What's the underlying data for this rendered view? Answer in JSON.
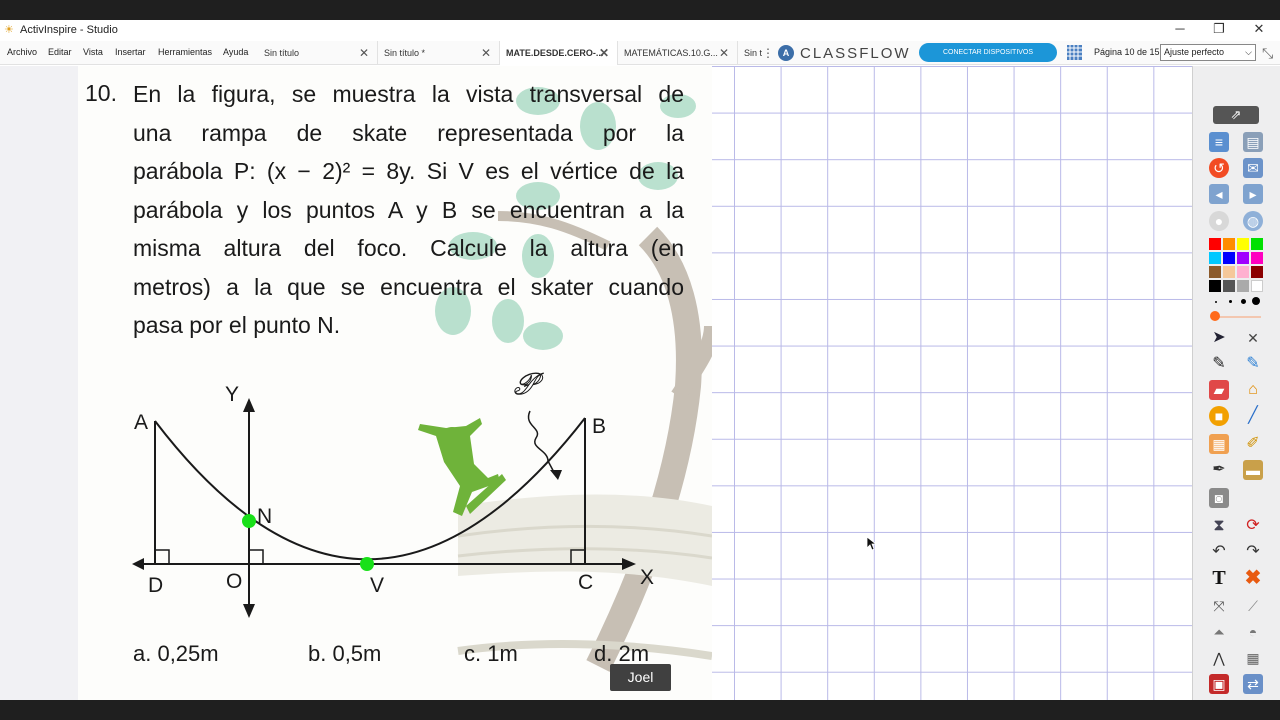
{
  "window": {
    "title": "ActivInspire - Studio",
    "minimize": "─",
    "maximize": "❐",
    "close": "✕"
  },
  "menus": [
    "Archivo",
    "Editar",
    "Vista",
    "Insertar",
    "Herramientas",
    "Ayuda"
  ],
  "tabs": [
    {
      "label": "Sin título",
      "close": "✕"
    },
    {
      "label": "Sin título *",
      "close": "✕"
    },
    {
      "label": "MATE.DESDE.CERO-...",
      "close": "✕"
    },
    {
      "label": "MATEMÁTICAS.10.G...",
      "close": "✕"
    },
    {
      "label": "Sin t",
      "close": "⋮"
    }
  ],
  "classflow": {
    "logo": "A",
    "word": "CLASSFLOW"
  },
  "connect_button": "CONECTAR DISPOSITIVOS",
  "page_info": "Página 10 de 15",
  "zoom": {
    "selected": "Ajuste perfecto"
  },
  "problem": {
    "number": "10.",
    "lines": [
      "En la figura, se muestra la vista transversal de",
      "una rampa de skate representada por la",
      "parábola P: (x − 2)² = 8y. Si V es el vértice de la",
      "parábola y los puntos A y B se encuentran a la",
      "misma altura del foco. Calcule la altura (en",
      "metros) a la que se encuentra el skater cuando",
      "pasa por el punto N."
    ],
    "figure_labels": {
      "Y": "Y",
      "X": "X",
      "A": "A",
      "B": "B",
      "N": "N",
      "D": "D",
      "O": "O",
      "V": "V",
      "C": "C",
      "P": "𝒫"
    },
    "answers": [
      "a. 0,25m",
      "b. 0,5m",
      "c. 1m",
      "d. 2m"
    ]
  },
  "presenter_label": "Joel",
  "colors": {
    "accent": "#1c96d8",
    "grid": "#b9b9e8",
    "point": "#19e019",
    "skater": "#6fb33a"
  }
}
